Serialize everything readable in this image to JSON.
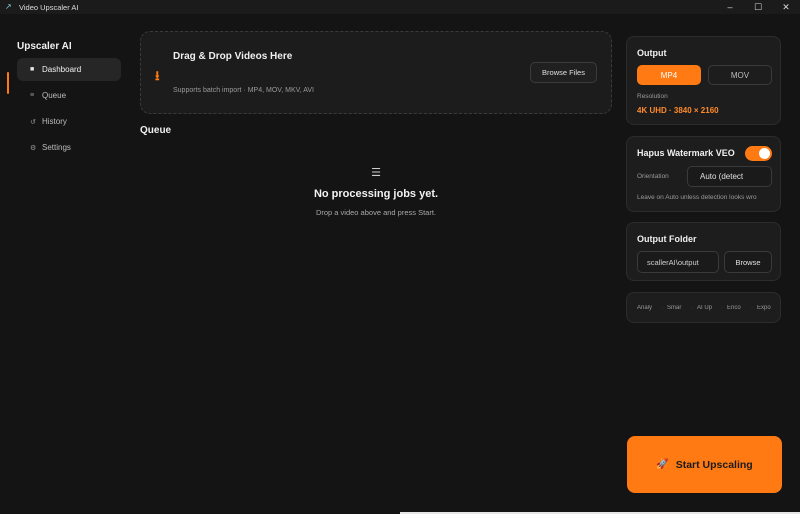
{
  "window": {
    "title": "Video Upscaler AI",
    "icon": "app-logo-icon",
    "controls": [
      "minimize-icon",
      "maximize-icon",
      "close-icon"
    ]
  },
  "sidebar": {
    "brand": "Upscaler AI",
    "items": [
      {
        "label": "Dashboard",
        "icon": "dashboard-icon",
        "active": true
      },
      {
        "label": "Queue",
        "icon": "list-icon",
        "active": false
      },
      {
        "label": "History",
        "icon": "history-icon",
        "active": false
      },
      {
        "label": "Settings",
        "icon": "gear-icon",
        "active": false
      }
    ]
  },
  "dropzone": {
    "title": "Drag & Drop Videos Here",
    "subtitle": "Supports batch import · MP4, MOV, MKV, AVI",
    "browse_label": "Browse Files",
    "icon": "download-arrow-icon"
  },
  "queue": {
    "title": "Queue",
    "empty_title": "No processing jobs yet.",
    "empty_subtitle": "Drop a video above and press Start."
  },
  "output": {
    "title": "Output",
    "formats": [
      "MP4",
      "MOV"
    ],
    "selected_format": "MP4",
    "resolution_label": "Resolution",
    "resolution_value": "4K UHD · 3840 × 2160"
  },
  "watermark": {
    "title": "Hapus Watermark VEO",
    "enabled": true,
    "orientation_label": "Orientation",
    "orientation_value": "Auto (detect",
    "hint": "Leave on Auto unless detection looks wro"
  },
  "output_folder": {
    "title": "Output Folder",
    "path": "scallerAI\\output",
    "browse_label": "Browse"
  },
  "steps": [
    "Analy",
    "Smar",
    "AI Up",
    "Enco",
    "Expo"
  ],
  "start_button": {
    "label": "Start Upscaling",
    "icon": "rocket-icon"
  },
  "colors": {
    "accent": "#ff7a12",
    "background": "#141414",
    "panel": "#1d1d1d"
  }
}
